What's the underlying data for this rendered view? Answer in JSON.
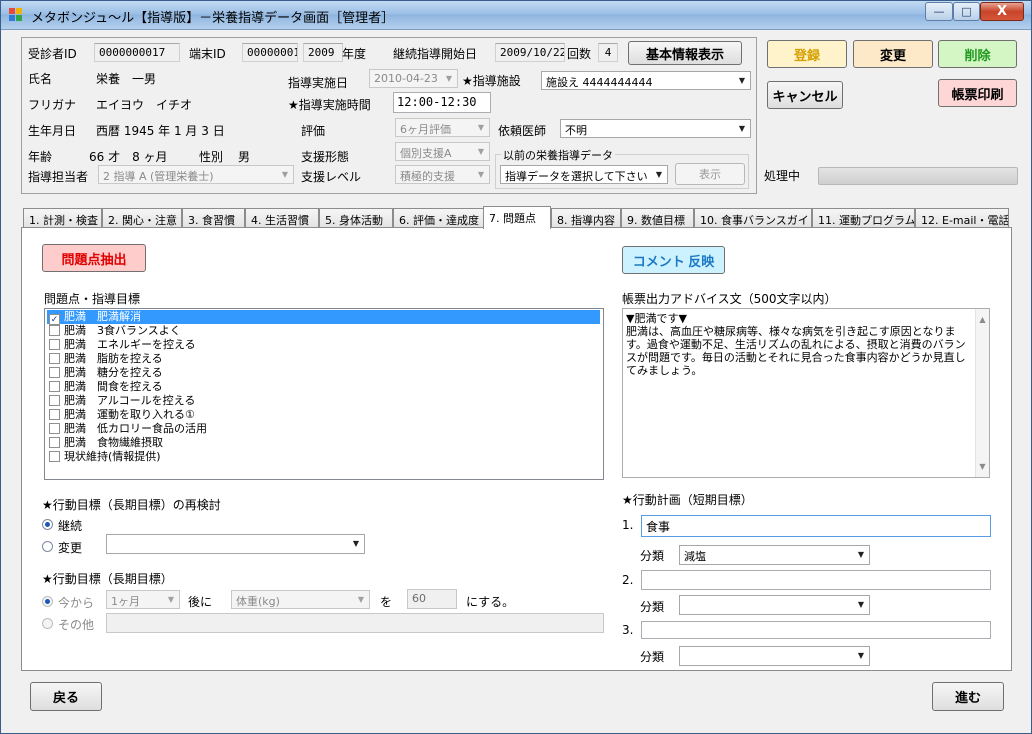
{
  "window": {
    "title": "メタボンジュ～ル【指導版】－栄養指導データ画面［管理者］",
    "minimize_glyph": "—",
    "maximize_glyph": "□",
    "close_glyph": "X"
  },
  "header": {
    "recipient_id_label": "受診者ID",
    "recipient_id": "0000000017",
    "terminal_id_label": "端末ID",
    "terminal_id": "00000001",
    "fiscal_year": "2009",
    "fiscal_year_suffix": "年度",
    "continuation_start_label": "継続指導開始日",
    "continuation_start": "2009/10/22",
    "count_label": "回数",
    "count": "4",
    "basic_info_button": "基本情報表示",
    "name_label": "氏名",
    "name": "栄養　一男",
    "furigana_label": "フリガナ",
    "furigana": "エイヨウ　イチオ",
    "birthdate_label": "生年月日",
    "birthdate": "西暦 1945 年 1 月 3 日",
    "age_label": "年齢",
    "age": "66 才　8 ヶ月",
    "gender_label": "性別",
    "gender": "男",
    "instructor_label": "指導担当者",
    "instructor": "2 指導 A (管理栄養士)",
    "guidance_date_label": "指導実施日",
    "guidance_date": "2010-04-23",
    "facility_label": "★指導施設",
    "facility": "施設え 4444444444",
    "guidance_time_label": "★指導実施時間",
    "time_start_hour": "12",
    "time_start_min": "00",
    "time_end_hour": "12",
    "time_end_min": "30",
    "colon": ":",
    "dash": "-",
    "evaluation_label": "評価",
    "evaluation": "6ヶ月評価",
    "doctor_label": "依頼医師",
    "doctor": "不明",
    "support_form_label": "支援形態",
    "support_form": "個別支援A",
    "previous_label": "以前の栄養指導データ",
    "previous_select": "指導データを選択して下さい",
    "show_button": "表示",
    "support_level_label": "支援レベル",
    "support_level": "積極的支援"
  },
  "actions": {
    "register": "登録",
    "change": "変更",
    "delete": "削除",
    "cancel": "キャンセル",
    "print": "帳票印刷",
    "processing_label": "処理中",
    "processing_progress": 0
  },
  "tabs": [
    "1. 計測・検査",
    "2. 関心・注意",
    "3. 食習慣",
    "4. 生活習慣",
    "5. 身体活動",
    "6. 評価・達成度",
    "7. 問題点",
    "8. 指導内容",
    "9. 数値目標",
    "10. 食事バランスガイド",
    "11. 運動プログラム",
    "12. E-mail・電話"
  ],
  "active_tab_index": 6,
  "problems": {
    "extract_button": "問題点抽出",
    "list_title": "問題点・指導目標",
    "check_glyph": "✓",
    "items": [
      {
        "label": "肥満　肥満解消",
        "checked": true,
        "selected": true
      },
      {
        "label": "肥満　3食バランスよく",
        "checked": false,
        "selected": false
      },
      {
        "label": "肥満　エネルギーを控える",
        "checked": false,
        "selected": false
      },
      {
        "label": "肥満　脂肪を控える",
        "checked": false,
        "selected": false
      },
      {
        "label": "肥満　糖分を控える",
        "checked": false,
        "selected": false
      },
      {
        "label": "肥満　間食を控える",
        "checked": false,
        "selected": false
      },
      {
        "label": "肥満　アルコールを控える",
        "checked": false,
        "selected": false
      },
      {
        "label": "肥満　運動を取り入れる①",
        "checked": false,
        "selected": false
      },
      {
        "label": "肥満　低カロリー食品の活用",
        "checked": false,
        "selected": false
      },
      {
        "label": "肥満　食物繊維摂取",
        "checked": false,
        "selected": false
      },
      {
        "label": "現状維持(情報提供)",
        "checked": false,
        "selected": false
      }
    ]
  },
  "advice": {
    "comment_button": "コメント 反映",
    "title": "帳票出力アドバイス文（500文字以内）",
    "text": "▼肥満です▼\n肥満は、高血圧や糖尿病等、様々な病気を引き起こす原因となります。過食や運動不足、生活リズムの乱れによる、摂取と消費のバランスが問題です。毎日の活動とそれに見合った食事内容かどうか見直してみましょう。",
    "scroll_up_glyph": "▲",
    "scroll_down_glyph": "▼"
  },
  "long_term_review": {
    "title": "★行動目標（長期目標）の再検討",
    "continue": "継続",
    "change": "変更",
    "selected": "continue",
    "change_select": ""
  },
  "long_term": {
    "title": "★行動目標（長期目標）",
    "from_now": "今から",
    "period": "1ヶ月",
    "after": "後に",
    "item": "体重(kg)",
    "wo": "を",
    "value": "60",
    "suffix": "にする。",
    "other": "その他",
    "other_text": ""
  },
  "short_term": {
    "title": "★行動計画（短期目標）",
    "category_label": "分類",
    "plans": [
      {
        "no": "1.",
        "text": "食事",
        "category": "減塩"
      },
      {
        "no": "2.",
        "text": "",
        "category": ""
      },
      {
        "no": "3.",
        "text": "",
        "category": ""
      }
    ]
  },
  "footer": {
    "back": "戻る",
    "next": "進む"
  },
  "dropdown_glyph": "▼",
  "colors": {
    "register_bg": "#fff3cc",
    "register_fg": "#d6a000",
    "change_bg": "#fde9c8",
    "delete_bg": "#d4f5c4",
    "delete_fg": "#1f9a1f",
    "print_bg": "#ffd6d6",
    "extract_bg": "#ffcccc",
    "extract_fg": "#e00000",
    "comment_bg": "#ccf2ff",
    "comment_fg": "#1b78c4",
    "list_selection": "#3399ff"
  }
}
